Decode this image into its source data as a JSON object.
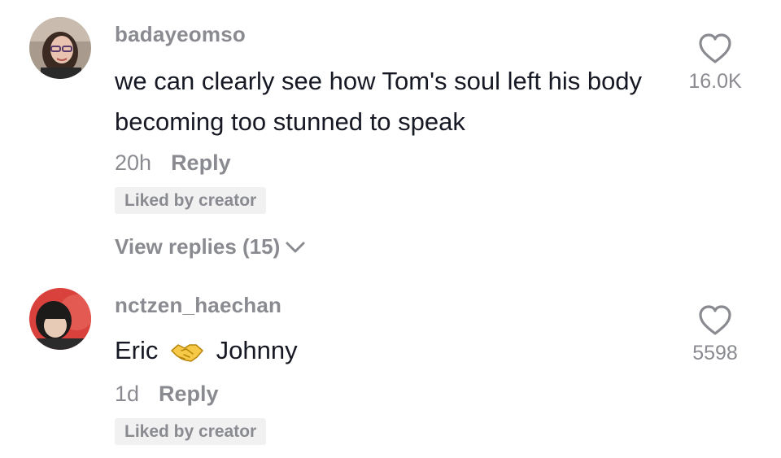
{
  "comments": [
    {
      "username": "badayeomso",
      "text": "we can clearly see how Tom's soul left his body becoming too stunned to speak",
      "time": "20h",
      "reply_label": "Reply",
      "badge": "Liked by creator",
      "view_replies": "View replies (15)",
      "likes": "16.0K",
      "icons": {
        "like": "heart-outline-icon",
        "expand": "chevron-down-icon"
      }
    },
    {
      "username": "nctzen_haechan",
      "text_before": "Eric",
      "emoji": "handshake-emoji",
      "text_after": "Johnny",
      "time": "1d",
      "reply_label": "Reply",
      "badge": "Liked by creator",
      "likes": "5598",
      "icons": {
        "like": "heart-outline-icon"
      }
    }
  ],
  "colors": {
    "secondary_text": "#8a8b91",
    "primary_text": "#161823",
    "badge_bg": "#f1f1f2"
  }
}
